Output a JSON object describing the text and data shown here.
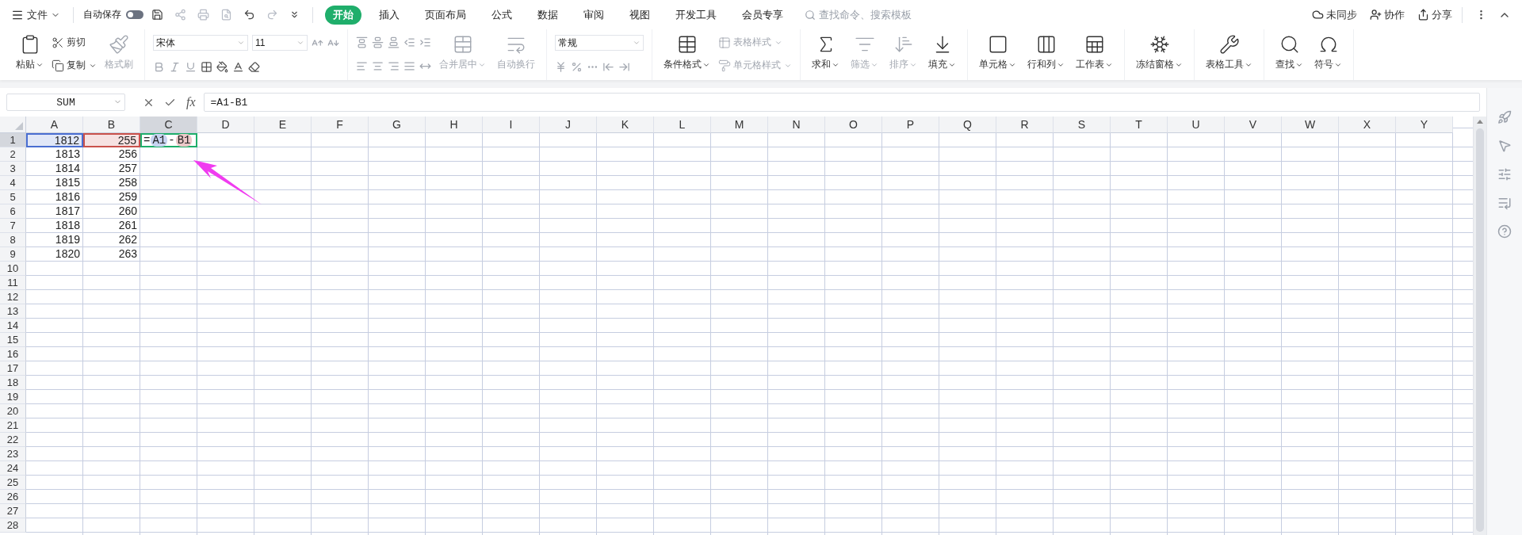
{
  "menu": {
    "file": "文件",
    "autosave": {
      "label": "自动保存",
      "on": false
    },
    "tabs": [
      {
        "label": "开始",
        "selected": true
      },
      {
        "label": "插入",
        "selected": false
      },
      {
        "label": "页面布局",
        "selected": false
      },
      {
        "label": "公式",
        "selected": false
      },
      {
        "label": "数据",
        "selected": false
      },
      {
        "label": "审阅",
        "selected": false
      },
      {
        "label": "视图",
        "selected": false
      },
      {
        "label": "开发工具",
        "selected": false
      },
      {
        "label": "会员专享",
        "selected": false
      }
    ],
    "search": {
      "placeholder": "查找命令、搜索模板"
    },
    "actions": [
      {
        "kind": "cloud",
        "label": "未同步"
      },
      {
        "kind": "user",
        "label": "协作"
      },
      {
        "kind": "share",
        "label": "分享"
      }
    ]
  },
  "ribbon": [
    {
      "items": [
        {
          "kind": "large",
          "label": "粘贴",
          "dropdown": true,
          "disabled": false
        },
        {
          "kind": "pair",
          "items": [
            {
              "label": "剪切",
              "dropdown": false,
              "disabled": false
            },
            {
              "label": "复制",
              "dropdown": true,
              "disabled": false
            }
          ]
        },
        {
          "kind": "large",
          "label": "格式刷",
          "dropdown": false,
          "disabled": true
        }
      ]
    },
    {
      "items": [
        {
          "kind": "font",
          "font": "宋体",
          "size": "11"
        }
      ]
    },
    {
      "items": [
        {
          "kind": "align"
        },
        {
          "kind": "large",
          "label": "合并居中",
          "dropdown": true,
          "disabled": true
        },
        {
          "kind": "large",
          "label": "自动换行",
          "dropdown": false,
          "disabled": true
        }
      ]
    },
    {
      "items": [
        {
          "kind": "number",
          "format": "常规"
        }
      ]
    },
    {
      "items": [
        {
          "kind": "large",
          "label": "条件格式",
          "dropdown": true,
          "disabled": false
        },
        {
          "kind": "pair",
          "items": [
            {
              "label": "表格样式",
              "dropdown": true,
              "disabled": true
            },
            {
              "label": "单元格样式",
              "dropdown": true,
              "disabled": true
            }
          ]
        }
      ]
    },
    {
      "items": [
        {
          "kind": "large",
          "label": "求和",
          "dropdown": true,
          "disabled": false
        },
        {
          "kind": "large",
          "label": "筛选",
          "dropdown": true,
          "disabled": true
        },
        {
          "kind": "large",
          "label": "排序",
          "dropdown": true,
          "disabled": true
        },
        {
          "kind": "large",
          "label": "填充",
          "dropdown": true,
          "disabled": false
        }
      ]
    },
    {
      "items": [
        {
          "kind": "large",
          "label": "单元格",
          "dropdown": true,
          "disabled": false
        },
        {
          "kind": "large",
          "label": "行和列",
          "dropdown": true,
          "disabled": false
        },
        {
          "kind": "large",
          "label": "工作表",
          "dropdown": true,
          "disabled": false
        }
      ]
    },
    {
      "items": [
        {
          "kind": "large",
          "label": "冻结窗格",
          "dropdown": true,
          "disabled": false
        }
      ]
    },
    {
      "items": [
        {
          "kind": "large",
          "label": "表格工具",
          "dropdown": true,
          "disabled": false
        }
      ]
    },
    {
      "items": [
        {
          "kind": "large",
          "label": "查找",
          "dropdown": true,
          "disabled": false
        },
        {
          "kind": "large",
          "label": "符号",
          "dropdown": true,
          "disabled": false
        }
      ]
    }
  ],
  "formula_bar": {
    "name_box": "SUM",
    "fx": "fx",
    "formula": "=A1-B1"
  },
  "sheet": {
    "columns": [
      {
        "label": "A",
        "selected": false
      },
      {
        "label": "B",
        "selected": false
      },
      {
        "label": "C",
        "selected": true
      },
      {
        "label": "D",
        "selected": false
      },
      {
        "label": "E",
        "selected": false
      },
      {
        "label": "F",
        "selected": false
      },
      {
        "label": "G",
        "selected": false
      },
      {
        "label": "H",
        "selected": false
      },
      {
        "label": "I",
        "selected": false
      },
      {
        "label": "J",
        "selected": false
      },
      {
        "label": "K",
        "selected": false
      },
      {
        "label": "L",
        "selected": false
      },
      {
        "label": "M",
        "selected": false
      },
      {
        "label": "N",
        "selected": false
      },
      {
        "label": "O",
        "selected": false
      },
      {
        "label": "P",
        "selected": false
      },
      {
        "label": "Q",
        "selected": false
      },
      {
        "label": "R",
        "selected": false
      },
      {
        "label": "S",
        "selected": false
      },
      {
        "label": "T",
        "selected": false
      },
      {
        "label": "U",
        "selected": false
      },
      {
        "label": "V",
        "selected": false
      },
      {
        "label": "W",
        "selected": false
      },
      {
        "label": "X",
        "selected": false
      },
      {
        "label": "Y",
        "selected": false
      }
    ],
    "rows": [
      {
        "label": "1",
        "selected": true,
        "cells": [
          {
            "kind": "value",
            "text": "1812",
            "color": "#4a6ed1"
          },
          {
            "kind": "value",
            "text": "255",
            "color": "#c9514c"
          },
          {
            "kind": "editing",
            "parts": [
              {
                "kind": "op",
                "text": "="
              },
              {
                "kind": "ref",
                "text": "A1",
                "color": "#c8d4f2"
              },
              {
                "kind": "op",
                "text": "-"
              },
              {
                "kind": "ref",
                "text": "B1",
                "color": "#ecc8c8"
              }
            ]
          }
        ]
      },
      {
        "label": "2",
        "selected": false,
        "cells": [
          {
            "kind": "value",
            "text": "1813"
          },
          {
            "kind": "value",
            "text": "256"
          }
        ]
      },
      {
        "label": "3",
        "selected": false,
        "cells": [
          {
            "kind": "value",
            "text": "1814"
          },
          {
            "kind": "value",
            "text": "257"
          }
        ]
      },
      {
        "label": "4",
        "selected": false,
        "cells": [
          {
            "kind": "value",
            "text": "1815"
          },
          {
            "kind": "value",
            "text": "258"
          }
        ]
      },
      {
        "label": "5",
        "selected": false,
        "cells": [
          {
            "kind": "value",
            "text": "1816"
          },
          {
            "kind": "value",
            "text": "259"
          }
        ]
      },
      {
        "label": "6",
        "selected": false,
        "cells": [
          {
            "kind": "value",
            "text": "1817"
          },
          {
            "kind": "value",
            "text": "260"
          }
        ]
      },
      {
        "label": "7",
        "selected": false,
        "cells": [
          {
            "kind": "value",
            "text": "1818"
          },
          {
            "kind": "value",
            "text": "261"
          }
        ]
      },
      {
        "label": "8",
        "selected": false,
        "cells": [
          {
            "kind": "value",
            "text": "1819"
          },
          {
            "kind": "value",
            "text": "262"
          }
        ]
      },
      {
        "label": "9",
        "selected": false,
        "cells": [
          {
            "kind": "value",
            "text": "1820"
          },
          {
            "kind": "value",
            "text": "263"
          }
        ]
      },
      {
        "label": "10",
        "selected": false
      },
      {
        "label": "11",
        "selected": false
      },
      {
        "label": "12",
        "selected": false
      },
      {
        "label": "13",
        "selected": false
      },
      {
        "label": "14",
        "selected": false
      },
      {
        "label": "15",
        "selected": false
      },
      {
        "label": "16",
        "selected": false
      },
      {
        "label": "17",
        "selected": false
      },
      {
        "label": "18",
        "selected": false
      },
      {
        "label": "19",
        "selected": false
      },
      {
        "label": "20",
        "selected": false
      },
      {
        "label": "21",
        "selected": false
      },
      {
        "label": "22",
        "selected": false
      },
      {
        "label": "23",
        "selected": false
      },
      {
        "label": "24",
        "selected": false
      },
      {
        "label": "25",
        "selected": false
      },
      {
        "label": "26",
        "selected": false
      },
      {
        "label": "27",
        "selected": false
      },
      {
        "label": "28",
        "selected": false
      }
    ]
  }
}
